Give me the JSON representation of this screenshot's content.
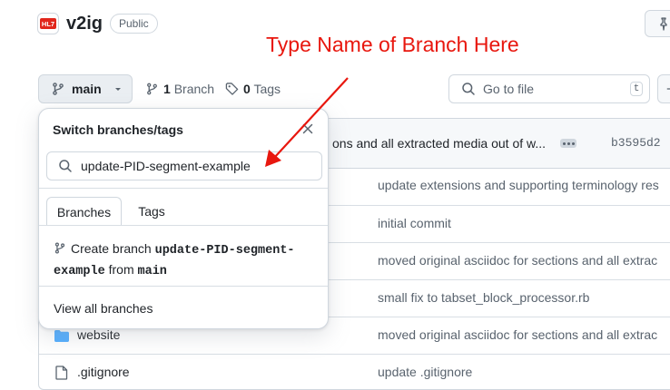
{
  "header": {
    "logo_text": "HL7",
    "repo_name": "v2ig",
    "visibility": "Public"
  },
  "annotation": {
    "text": "Type Name of Branch Here"
  },
  "toolbar": {
    "branch_label": "main",
    "branch_count_num": "1",
    "branch_count_label": "Branch",
    "tag_count_num": "0",
    "tag_count_label": "Tags",
    "go_to_file": "Go to file",
    "go_to_file_key": "t"
  },
  "dropdown": {
    "title": "Switch branches/tags",
    "filter_value": "update-PID-segment-example",
    "tabs": [
      "Branches",
      "Tags"
    ],
    "create_prefix": "Create branch",
    "create_branch_name": "update-PID-segment-example",
    "create_from_word": "from",
    "create_from_branch": "main",
    "view_all": "View all branches"
  },
  "latest_commit": {
    "message": "ons and all extracted media out of w...",
    "sha": "b3595d2 · "
  },
  "files": [
    {
      "name": "",
      "message": "update extensions and supporting terminology res"
    },
    {
      "name": "",
      "message": "initial commit"
    },
    {
      "name": "",
      "message": "moved original asciidoc for sections and all extrac"
    },
    {
      "name": "",
      "message": "small fix to tabset_block_processor.rb"
    },
    {
      "name": "website",
      "message": "moved original asciidoc for sections and all extrac",
      "type": "folder"
    },
    {
      "name": ".gitignore",
      "message": "update .gitignore",
      "type": "file"
    }
  ],
  "colors": {
    "annotation": "#e8170e",
    "folder": "#54aeff"
  }
}
